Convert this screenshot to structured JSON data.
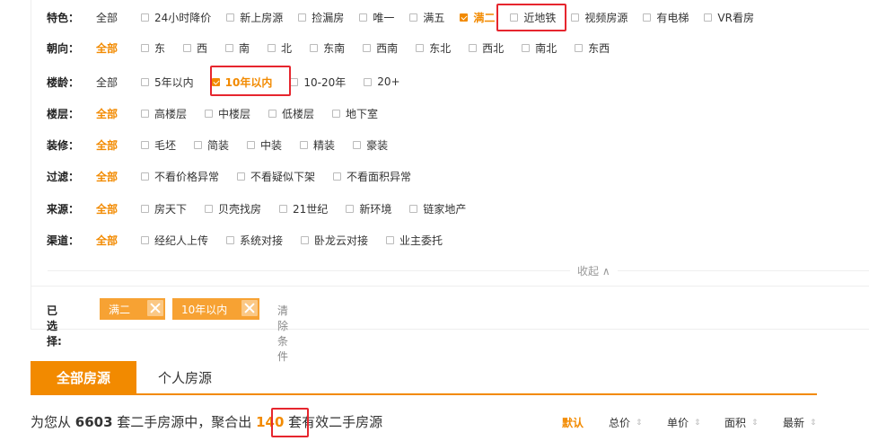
{
  "filters": [
    {
      "label": "特色：",
      "all": "全部",
      "all_active": false,
      "options": [
        {
          "text": "24小时降价",
          "checked": false
        },
        {
          "text": "新上房源",
          "checked": false
        },
        {
          "text": "捡漏房",
          "checked": false
        },
        {
          "text": "唯一",
          "checked": false
        },
        {
          "text": "满五",
          "checked": false
        },
        {
          "text": "满二",
          "checked": true
        },
        {
          "text": "近地铁",
          "checked": false
        },
        {
          "text": "视频房源",
          "checked": false
        },
        {
          "text": "有电梯",
          "checked": false
        },
        {
          "text": "VR看房",
          "checked": false
        }
      ]
    },
    {
      "label": "朝向：",
      "all": "全部",
      "all_active": true,
      "options": [
        {
          "text": "东",
          "checked": false
        },
        {
          "text": "西",
          "checked": false
        },
        {
          "text": "南",
          "checked": false
        },
        {
          "text": "北",
          "checked": false
        },
        {
          "text": "东南",
          "checked": false
        },
        {
          "text": "西南",
          "checked": false
        },
        {
          "text": "东北",
          "checked": false
        },
        {
          "text": "西北",
          "checked": false
        },
        {
          "text": "南北",
          "checked": false
        },
        {
          "text": "东西",
          "checked": false
        }
      ]
    },
    {
      "label": "楼龄：",
      "all": "全部",
      "all_active": false,
      "options": [
        {
          "text": "5年以内",
          "checked": false
        },
        {
          "text": "10年以内",
          "checked": true
        },
        {
          "text": "10-20年",
          "checked": false
        },
        {
          "text": "20+",
          "checked": false
        }
      ]
    },
    {
      "label": "楼层：",
      "all": "全部",
      "all_active": true,
      "options": [
        {
          "text": "高楼层",
          "checked": false
        },
        {
          "text": "中楼层",
          "checked": false
        },
        {
          "text": "低楼层",
          "checked": false
        },
        {
          "text": "地下室",
          "checked": false
        }
      ]
    },
    {
      "label": "装修：",
      "all": "全部",
      "all_active": true,
      "options": [
        {
          "text": "毛坯",
          "checked": false
        },
        {
          "text": "简装",
          "checked": false
        },
        {
          "text": "中装",
          "checked": false
        },
        {
          "text": "精装",
          "checked": false
        },
        {
          "text": "豪装",
          "checked": false
        }
      ]
    },
    {
      "label": "过滤：",
      "all": "全部",
      "all_active": true,
      "options": [
        {
          "text": "不看价格异常",
          "checked": false
        },
        {
          "text": "不看疑似下架",
          "checked": false
        },
        {
          "text": "不看面积异常",
          "checked": false
        }
      ]
    },
    {
      "label": "来源：",
      "all": "全部",
      "all_active": true,
      "options": [
        {
          "text": "房天下",
          "checked": false
        },
        {
          "text": "贝壳找房",
          "checked": false
        },
        {
          "text": "21世纪",
          "checked": false
        },
        {
          "text": "新环境",
          "checked": false
        },
        {
          "text": "链家地产",
          "checked": false
        }
      ]
    },
    {
      "label": "渠道：",
      "all": "全部",
      "all_active": true,
      "options": [
        {
          "text": "经纪人上传",
          "checked": false
        },
        {
          "text": "系统对接",
          "checked": false
        },
        {
          "text": "卧龙云对接",
          "checked": false
        },
        {
          "text": "业主委托",
          "checked": false
        }
      ]
    }
  ],
  "collapse_label": "收起 ∧",
  "selected": {
    "label": "已选择:",
    "tags": [
      "满二",
      "10年以内"
    ],
    "clear": "清除条件"
  },
  "tabs": [
    {
      "label": "全部房源",
      "active": true
    },
    {
      "label": "个人房源",
      "active": false
    }
  ],
  "summary": {
    "prefix": "为您从 ",
    "total": "6603",
    "mid": " 套二手房源中，聚合出 ",
    "count": "140",
    "suffix": " 套有效二手房源"
  },
  "sorts": [
    {
      "label": "默认",
      "active": true
    },
    {
      "label": "总价",
      "active": false
    },
    {
      "label": "单价",
      "active": false
    },
    {
      "label": "面积",
      "active": false
    },
    {
      "label": "最新",
      "active": false
    }
  ],
  "colors": {
    "accent": "#f28a00",
    "highlight_box": "#e6262e"
  }
}
